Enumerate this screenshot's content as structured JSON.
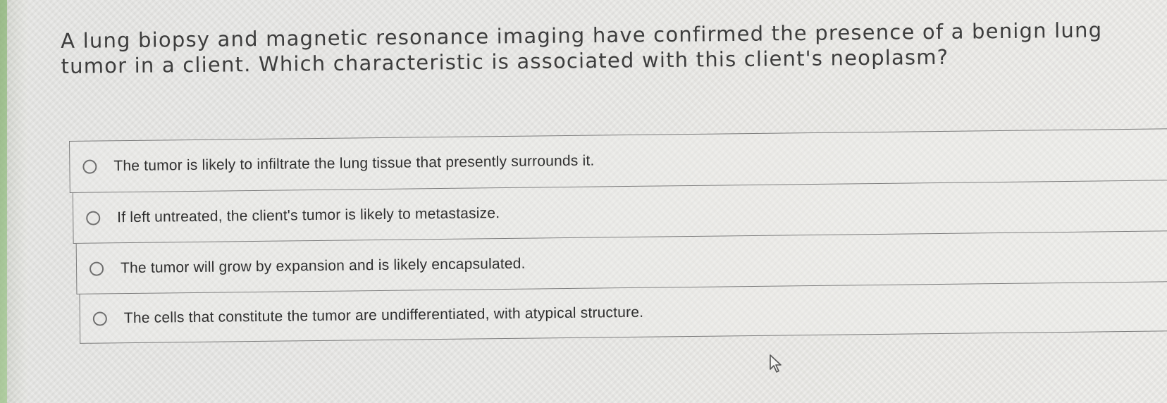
{
  "question": {
    "text": "A lung biopsy and magnetic resonance imaging have confirmed the presence of a benign lung tumor in a client. Which characteristic is associated with this client's neoplasm?"
  },
  "options": [
    {
      "label": "The tumor is likely to infiltrate the lung tissue that presently surrounds it.",
      "selected": false
    },
    {
      "label": "If left untreated, the client's tumor is likely to metastasize.",
      "selected": false
    },
    {
      "label": "The tumor will grow by expansion and is likely encapsulated.",
      "selected": false
    },
    {
      "label": "The cells that constitute the tumor are undifferentiated, with atypical structure.",
      "selected": false
    }
  ],
  "icons": {
    "radio": "radio-button-icon",
    "cursor": "mouse-pointer-icon"
  },
  "colors": {
    "background": "#ecebe8",
    "border": "#7d7d7d",
    "text": "#3d3d3d"
  }
}
